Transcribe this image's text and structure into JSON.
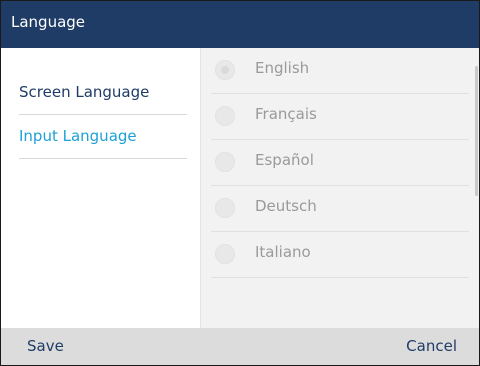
{
  "header": {
    "title": "Language"
  },
  "sidebar": {
    "items": [
      {
        "label": "Screen Language"
      },
      {
        "label": "Input Language"
      }
    ]
  },
  "options": [
    {
      "label": "English",
      "selected": true
    },
    {
      "label": "Français",
      "selected": false
    },
    {
      "label": "Español",
      "selected": false
    },
    {
      "label": "Deutsch",
      "selected": false
    },
    {
      "label": "Italiano",
      "selected": false
    }
  ],
  "softkeys": {
    "save_label": "Save",
    "cancel_label": "Cancel"
  },
  "colors": {
    "titlebar": "#1f3c66",
    "accent": "#1ea0d6",
    "text_dark": "#1f3c66",
    "option_text": "#9a9a9a",
    "softkey_bar": "#dcdcdc"
  }
}
